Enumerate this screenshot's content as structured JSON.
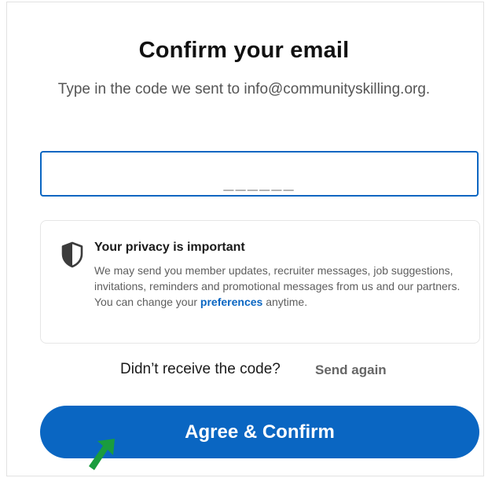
{
  "header": {
    "title": "Confirm your email",
    "subtitle": "Type in the code we sent to info@communityskilling.org."
  },
  "code_input": {
    "value": "",
    "placeholder": "______"
  },
  "privacy": {
    "icon": "shield-icon",
    "title": "Your privacy is important",
    "body_text": "We may send you member updates, recruiter messages, job suggestions, invitations, reminders and promotional messages from us and our partners. You can change your ",
    "link_label": "preferences",
    "body_suffix": " anytime."
  },
  "resend": {
    "question": "Didn’t receive the code?",
    "link_label": "Send again"
  },
  "confirm_button": {
    "label": "Agree & Confirm"
  },
  "colors": {
    "accent": "#0a66c2",
    "pointer": "#1a9c3e"
  }
}
